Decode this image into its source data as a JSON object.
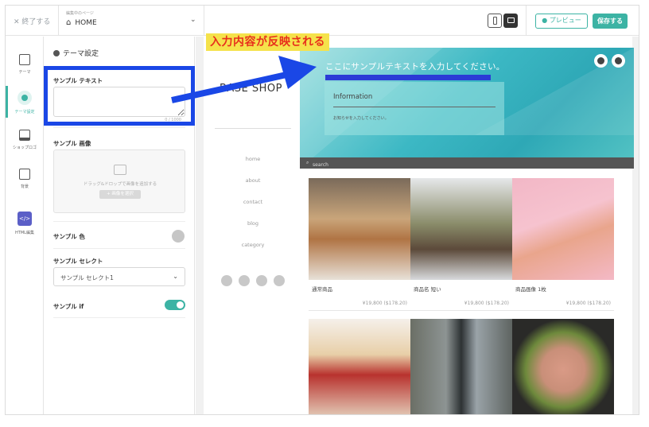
{
  "topbar": {
    "close_label": "✕ 終了する",
    "edit_page_label": "編集中のページ",
    "page_name": "HOME",
    "preview_label": "● プレビュー",
    "save_label": "保存する"
  },
  "leftnav": {
    "items": [
      {
        "label": "テーマ"
      },
      {
        "label": "テーマ設定"
      },
      {
        "label": "ショップロゴ"
      },
      {
        "label": "背景"
      },
      {
        "label": "HTML編集",
        "icon_text": "</>"
      }
    ]
  },
  "panel": {
    "title": "テーマ設定",
    "text_label": "サンプル テキスト",
    "text_counter": "0 / 1000",
    "image_label": "サンプル 画像",
    "upload_text": "ドラッグ&ドロップで画像を追加する",
    "upload_button": "+ 画像を選択",
    "color_label": "サンプル 色",
    "color_value": "#c6c6c6",
    "select_label": "サンプル セレクト",
    "select_value": "サンプル セレクト1",
    "toggle_label": "サンプル if",
    "toggle_on": true
  },
  "annotation": {
    "note": "入力内容が反映される",
    "box_color": "#1a47e6",
    "note_bg": "#f5e24b",
    "note_color": "#e8301c"
  },
  "site": {
    "logo": "BASE SHOP",
    "menu": [
      "home",
      "about",
      "contact",
      "blog",
      "category"
    ],
    "hero_text": "ここにサンプルテキストを入力してください。",
    "info_title": "Information",
    "info_text": "お知らせを入力してください。",
    "search_placeholder": "search",
    "products": [
      {
        "name": "通常商品",
        "price": "¥19,800 ($178.20)"
      },
      {
        "name": "商品名 短い",
        "price": "¥19,800 ($178.20)"
      },
      {
        "name": "商品画像 1枚",
        "price": "¥19,800 ($178.20)"
      }
    ],
    "accent_color": "#3cb3a4"
  }
}
